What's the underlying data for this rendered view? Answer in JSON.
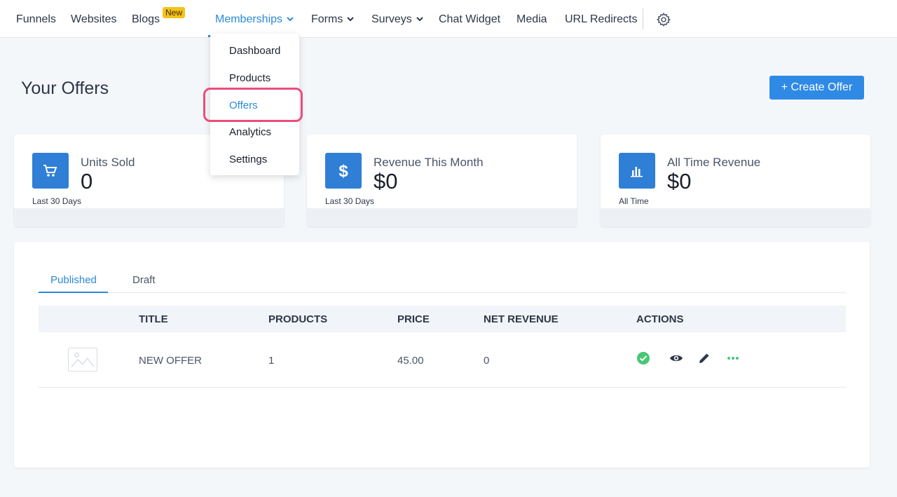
{
  "nav": {
    "items": [
      {
        "label": "Funnels"
      },
      {
        "label": "Websites"
      },
      {
        "label": "Blogs"
      },
      {
        "label": "Memberships"
      },
      {
        "label": "Forms"
      },
      {
        "label": "Surveys"
      },
      {
        "label": "Chat Widget"
      },
      {
        "label": "Media"
      },
      {
        "label": "URL Redirects"
      }
    ],
    "new_badge": "New",
    "active": "Memberships",
    "accent_color": "#2b8ad8"
  },
  "memberships_menu": {
    "items": [
      {
        "label": "Dashboard"
      },
      {
        "label": "Products"
      },
      {
        "label": "Offers"
      },
      {
        "label": "Analytics"
      },
      {
        "label": "Settings"
      }
    ],
    "selected": "Offers",
    "highlight_color": "#ec4d7a"
  },
  "page": {
    "title": "Your Offers",
    "create_button": "+ Create Offer"
  },
  "stats": [
    {
      "label": "Units Sold",
      "value": "0",
      "period": "Last 30 Days",
      "icon": "cart-icon"
    },
    {
      "label": "Revenue This Month",
      "value": "$0",
      "period": "Last 30 Days",
      "icon": "dollar-icon"
    },
    {
      "label": "All Time Revenue",
      "value": "$0",
      "period": "All Time",
      "icon": "bar-chart-icon"
    }
  ],
  "offers": {
    "tabs": [
      {
        "label": "Published"
      },
      {
        "label": "Draft"
      }
    ],
    "active_tab": "Published",
    "columns": [
      "TITLE",
      "PRODUCTS",
      "PRICE",
      "NET REVENUE",
      "ACTIONS"
    ],
    "rows": [
      {
        "title": "NEW OFFER",
        "products": "1",
        "price": "45.00",
        "net_revenue": "0",
        "status": "published"
      }
    ],
    "action_icons": [
      "check-circle-icon",
      "eye-icon",
      "pencil-icon",
      "more-icon"
    ]
  }
}
